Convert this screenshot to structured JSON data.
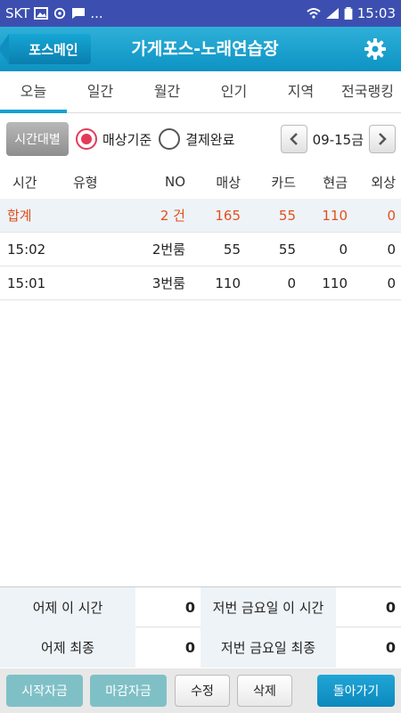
{
  "status": {
    "carrier": "SKT",
    "dots": "...",
    "time": "15:03"
  },
  "header": {
    "back_label": "포스메인",
    "title": "가게포스-노래연습장"
  },
  "tabs": [
    "오늘",
    "일간",
    "월간",
    "인기",
    "지역",
    "전국랭킹"
  ],
  "filter": {
    "time_button": "시간대별",
    "radio_sales": "매상기준",
    "radio_paid": "결제완료",
    "date": "09-15금"
  },
  "table": {
    "headers": [
      "시간",
      "유형",
      "NO",
      "매상",
      "카드",
      "현금",
      "외상"
    ],
    "total": {
      "label": "합계",
      "no": "2 건",
      "sales": "165",
      "card": "55",
      "cash": "110",
      "credit": "0"
    },
    "rows": [
      {
        "time": "15:02",
        "type": "",
        "no": "2번룸",
        "sales": "55",
        "card": "55",
        "cash": "0",
        "credit": "0"
      },
      {
        "time": "15:01",
        "type": "",
        "no": "3번룸",
        "sales": "110",
        "card": "0",
        "cash": "110",
        "credit": "0"
      }
    ]
  },
  "summary": {
    "yesterday_now_label": "어제 이 시간",
    "yesterday_now": "0",
    "last_fri_now_label": "저번 금요일 이 시간",
    "last_fri_now": "0",
    "yesterday_final_label": "어제 최종",
    "yesterday_final": "0",
    "last_fri_final_label": "저번 금요일 최종",
    "last_fri_final": "0"
  },
  "buttons": {
    "start": "시작자금",
    "close": "마감자금",
    "edit": "수정",
    "delete": "삭제",
    "back": "돌아가기"
  },
  "colors": {
    "accent": "#13a2d3",
    "status_bar": "#3c4fb0",
    "total_text": "#e0501d",
    "radio_on": "#e43a5a"
  }
}
